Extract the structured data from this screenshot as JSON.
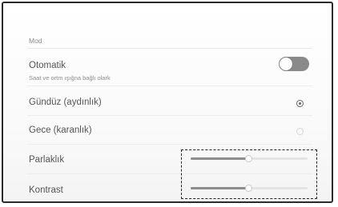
{
  "section": {
    "label": "Mod"
  },
  "auto": {
    "title": "Otomatik",
    "subtitle": "Saat ve ortm ışığna bağlı olark",
    "toggle_on": false
  },
  "modes": [
    {
      "label": "Gündüz (aydınlık)",
      "selected": true
    },
    {
      "label": "Gece (karanlık)",
      "selected": false
    }
  ],
  "sliders": [
    {
      "label": "Parlaklık",
      "value": 0.49
    },
    {
      "label": "Kontrast",
      "value": 0.49
    }
  ],
  "colors": {
    "track_fill": "#8c8c8c",
    "track_empty": "#e4e4e4",
    "toggle_off": "#8a8a8a"
  }
}
